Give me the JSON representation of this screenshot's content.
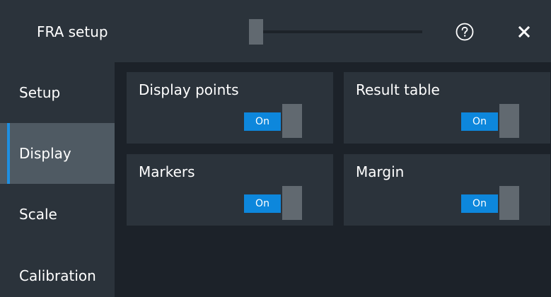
{
  "window": {
    "title": "FRA setup",
    "help_icon": "help-circle-icon",
    "close_icon": "close-icon"
  },
  "sidebar": {
    "items": [
      {
        "label": "Setup",
        "active": false
      },
      {
        "label": "Display",
        "active": true
      },
      {
        "label": "Scale",
        "active": false
      },
      {
        "label": "Calibration",
        "active": false
      }
    ]
  },
  "display": {
    "cards": [
      {
        "label": "Display points",
        "toggle": "On"
      },
      {
        "label": "Result table",
        "toggle": "On"
      },
      {
        "label": "Markers",
        "toggle": "On"
      },
      {
        "label": "Margin",
        "toggle": "On"
      }
    ]
  },
  "colors": {
    "accent": "#1e8fe1",
    "toggle_on": "#0d87dc",
    "panel": "#2b333b",
    "background": "#1c2229"
  }
}
